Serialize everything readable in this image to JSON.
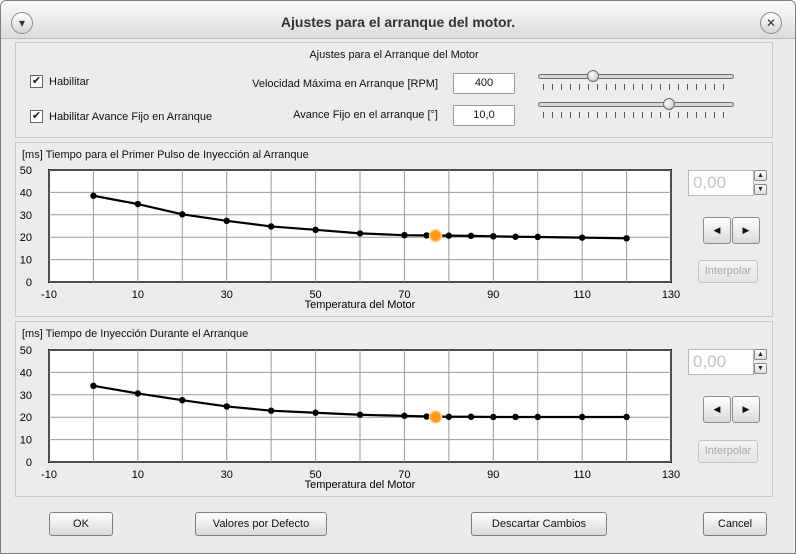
{
  "window": {
    "title": "Ajustes para el arranque del motor.",
    "menu_icon": "chevron-down-icon",
    "close_icon": "close-icon"
  },
  "settings": {
    "title": "Ajustes para el Arranque del Motor",
    "enable_label": "Habilitar",
    "enable_checked": true,
    "fixed_advance_label": "Habilitar Avance Fijo en Arranque",
    "fixed_advance_checked": true,
    "max_speed_label": "Velocidad Máxima en Arranque [RPM]",
    "max_speed_value": "400",
    "fixed_advance_field_label": "Avance Fijo en el arranque [°]",
    "fixed_advance_value": "10,0",
    "max_speed_slider_fraction": 0.28,
    "fixed_advance_slider_fraction": 0.67
  },
  "chart_data": [
    {
      "type": "line",
      "title": "[ms] Tiempo para el Primer Pulso de Inyección al Arranque",
      "xlabel": "Temperatura del Motor",
      "ylabel": "",
      "xlim": [
        -10,
        130
      ],
      "ylim": [
        0,
        50
      ],
      "x_ticks": [
        -10,
        10,
        30,
        50,
        70,
        90,
        110,
        130
      ],
      "x_tick_labels": [
        "-10",
        "10",
        "30",
        "50",
        "70",
        "90",
        "110",
        "130"
      ],
      "y_ticks": [
        0,
        10,
        20,
        30,
        40,
        50
      ],
      "x_gridlines": [
        -10,
        0,
        10,
        20,
        30,
        40,
        50,
        60,
        70,
        80,
        90,
        100,
        110,
        120,
        130
      ],
      "y_gridlines": [
        0,
        10,
        20,
        30,
        40,
        50
      ],
      "grid": true,
      "series": [
        {
          "x": [
            0,
            10,
            20,
            30,
            40,
            50,
            60,
            70,
            75,
            80,
            85,
            90,
            95,
            100,
            110,
            120
          ],
          "y": [
            38.5,
            34.8,
            30.2,
            27.3,
            24.8,
            23.3,
            21.7,
            20.9,
            20.8,
            20.7,
            20.6,
            20.4,
            20.2,
            20.1,
            19.8,
            19.5
          ]
        }
      ],
      "highlight": {
        "x": 77,
        "y": 20.7
      }
    },
    {
      "type": "line",
      "title": "[ms] Tiempo de Inyección Durante el Arranque",
      "xlabel": "Temperatura del Motor",
      "ylabel": "",
      "xlim": [
        -10,
        130
      ],
      "ylim": [
        0,
        50
      ],
      "x_ticks": [
        -10,
        10,
        30,
        50,
        70,
        90,
        110,
        130
      ],
      "x_tick_labels": [
        "-10",
        "10",
        "30",
        "50",
        "70",
        "90",
        "110",
        "130"
      ],
      "y_ticks": [
        0,
        10,
        20,
        30,
        40,
        50
      ],
      "x_gridlines": [
        -10,
        0,
        10,
        20,
        30,
        40,
        50,
        60,
        70,
        80,
        90,
        100,
        110,
        120,
        130
      ],
      "y_gridlines": [
        0,
        10,
        20,
        30,
        40,
        50
      ],
      "grid": true,
      "series": [
        {
          "x": [
            0,
            10,
            20,
            30,
            40,
            50,
            60,
            70,
            75,
            80,
            85,
            90,
            95,
            100,
            110,
            120
          ],
          "y": [
            34,
            30.6,
            27.6,
            24.8,
            22.9,
            22,
            21.1,
            20.6,
            20.3,
            20.2,
            20.2,
            20.1,
            20.1,
            20.1,
            20.1,
            20.1
          ]
        }
      ],
      "highlight": {
        "x": 77,
        "y": 20.1
      }
    }
  ],
  "chart_controls": [
    {
      "value": "0,00",
      "interpolate_label": "Interpolar"
    },
    {
      "value": "0,00",
      "interpolate_label": "Interpolar"
    }
  ],
  "footer": {
    "ok_label": "OK",
    "defaults_label": "Valores por Defecto",
    "discard_label": "Descartar Cambios",
    "cancel_label": "Cancel"
  },
  "colors": {
    "curve": "#000000",
    "grid": "#9a9a9a",
    "highlight": "#ff9a1e"
  }
}
